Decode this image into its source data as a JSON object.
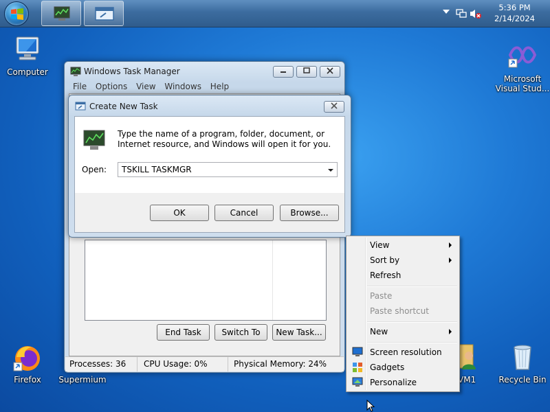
{
  "taskbar": {
    "clock_time": "5:36 PM",
    "clock_date": "2/14/2024",
    "buttons": [
      {
        "icon": "task-manager-icon"
      },
      {
        "icon": "run-dialog-icon"
      }
    ],
    "tray_icons": [
      "show-hidden-icons-arrow",
      "network-icon",
      "volume-muted-icon"
    ]
  },
  "desktop": {
    "icons": [
      {
        "label": "Computer",
        "icon": "computer-icon"
      },
      {
        "label": "Microsoft\nVisual Stud...",
        "icon": "visual-studio-icon"
      },
      {
        "label": "Firefox",
        "icon": "firefox-icon"
      },
      {
        "label": "Supermium",
        "icon": "supermium-icon"
      },
      {
        "label": "VM1",
        "icon": "user-folder-icon"
      },
      {
        "label": "Recycle Bin",
        "icon": "recycle-bin-icon"
      }
    ]
  },
  "task_manager": {
    "title": "Windows Task Manager",
    "menu": [
      "File",
      "Options",
      "View",
      "Windows",
      "Help"
    ],
    "buttons": {
      "end_task": "End Task",
      "switch_to": "Switch To",
      "new_task": "New Task..."
    },
    "status": {
      "processes": "Processes: 36",
      "cpu": "CPU Usage: 0%",
      "memory": "Physical Memory: 24%"
    }
  },
  "create_task": {
    "title": "Create New Task",
    "description": "Type the name of a program, folder, document, or Internet resource, and Windows will open it for you.",
    "open_label": "Open:",
    "open_value": "TSKILL TASKMGR",
    "ok": "OK",
    "cancel": "Cancel",
    "browse": "Browse..."
  },
  "context_menu": {
    "items": [
      {
        "label": "View",
        "submenu": true,
        "enabled": true
      },
      {
        "label": "Sort by",
        "submenu": true,
        "enabled": true
      },
      {
        "label": "Refresh",
        "submenu": false,
        "enabled": true
      },
      {
        "label": "Paste",
        "submenu": false,
        "enabled": false
      },
      {
        "label": "Paste shortcut",
        "submenu": false,
        "enabled": false
      },
      {
        "label": "New",
        "submenu": true,
        "enabled": true
      },
      {
        "label": "Screen resolution",
        "submenu": false,
        "enabled": true,
        "icon": "screen-resolution-icon"
      },
      {
        "label": "Gadgets",
        "submenu": false,
        "enabled": true,
        "icon": "gadgets-icon"
      },
      {
        "label": "Personalize",
        "submenu": false,
        "enabled": true,
        "icon": "personalize-icon"
      }
    ]
  }
}
